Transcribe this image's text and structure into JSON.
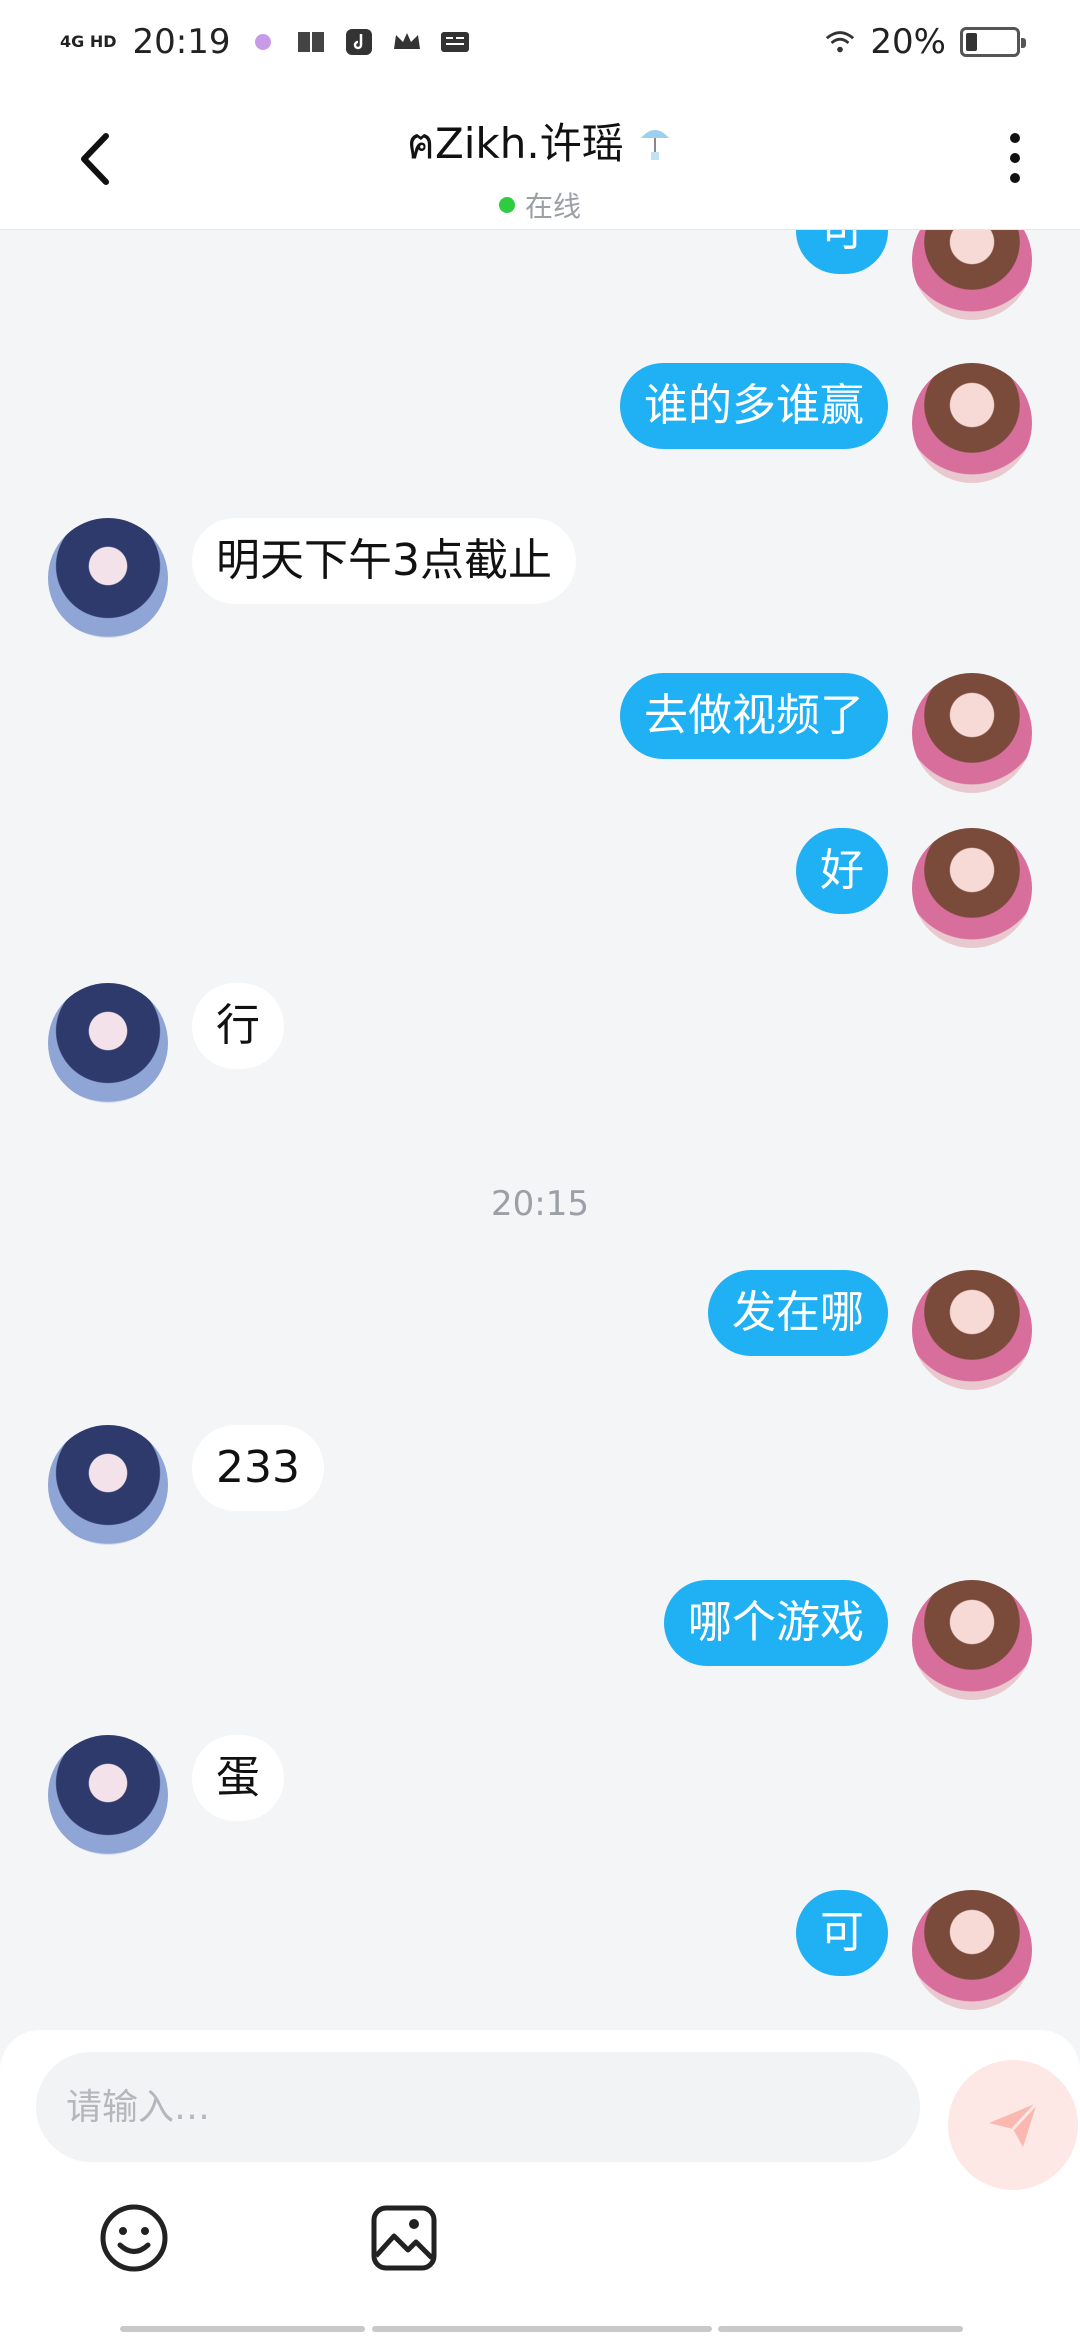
{
  "status_bar": {
    "network": "4G HD",
    "time": "20:19",
    "battery_percent": "20%",
    "battery_level": 0.2
  },
  "header": {
    "title": "ฅZikh.许瑶",
    "status": "在线",
    "status_color": "#2ecc40"
  },
  "colors": {
    "my_bubble": "#20b0f4",
    "their_bubble": "#ffffff",
    "background": "#f4f5f7"
  },
  "messages": [
    {
      "sender": "me",
      "text": "可"
    },
    {
      "sender": "me",
      "text": "谁的多谁赢"
    },
    {
      "sender": "them",
      "text": "明天下午3点截止"
    },
    {
      "sender": "me",
      "text": "去做视频了"
    },
    {
      "sender": "me",
      "text": "好"
    },
    {
      "sender": "them",
      "text": "行"
    },
    {
      "sender": "time",
      "text": "20:15"
    },
    {
      "sender": "me",
      "text": "发在哪"
    },
    {
      "sender": "them",
      "text": "233"
    },
    {
      "sender": "me",
      "text": "哪个游戏"
    },
    {
      "sender": "them",
      "text": "蛋"
    },
    {
      "sender": "me",
      "text": "可"
    }
  ],
  "composer": {
    "placeholder": "请输入…",
    "send_icon": "send-icon",
    "emoji_icon": "emoji-icon",
    "image_icon": "image-icon"
  }
}
